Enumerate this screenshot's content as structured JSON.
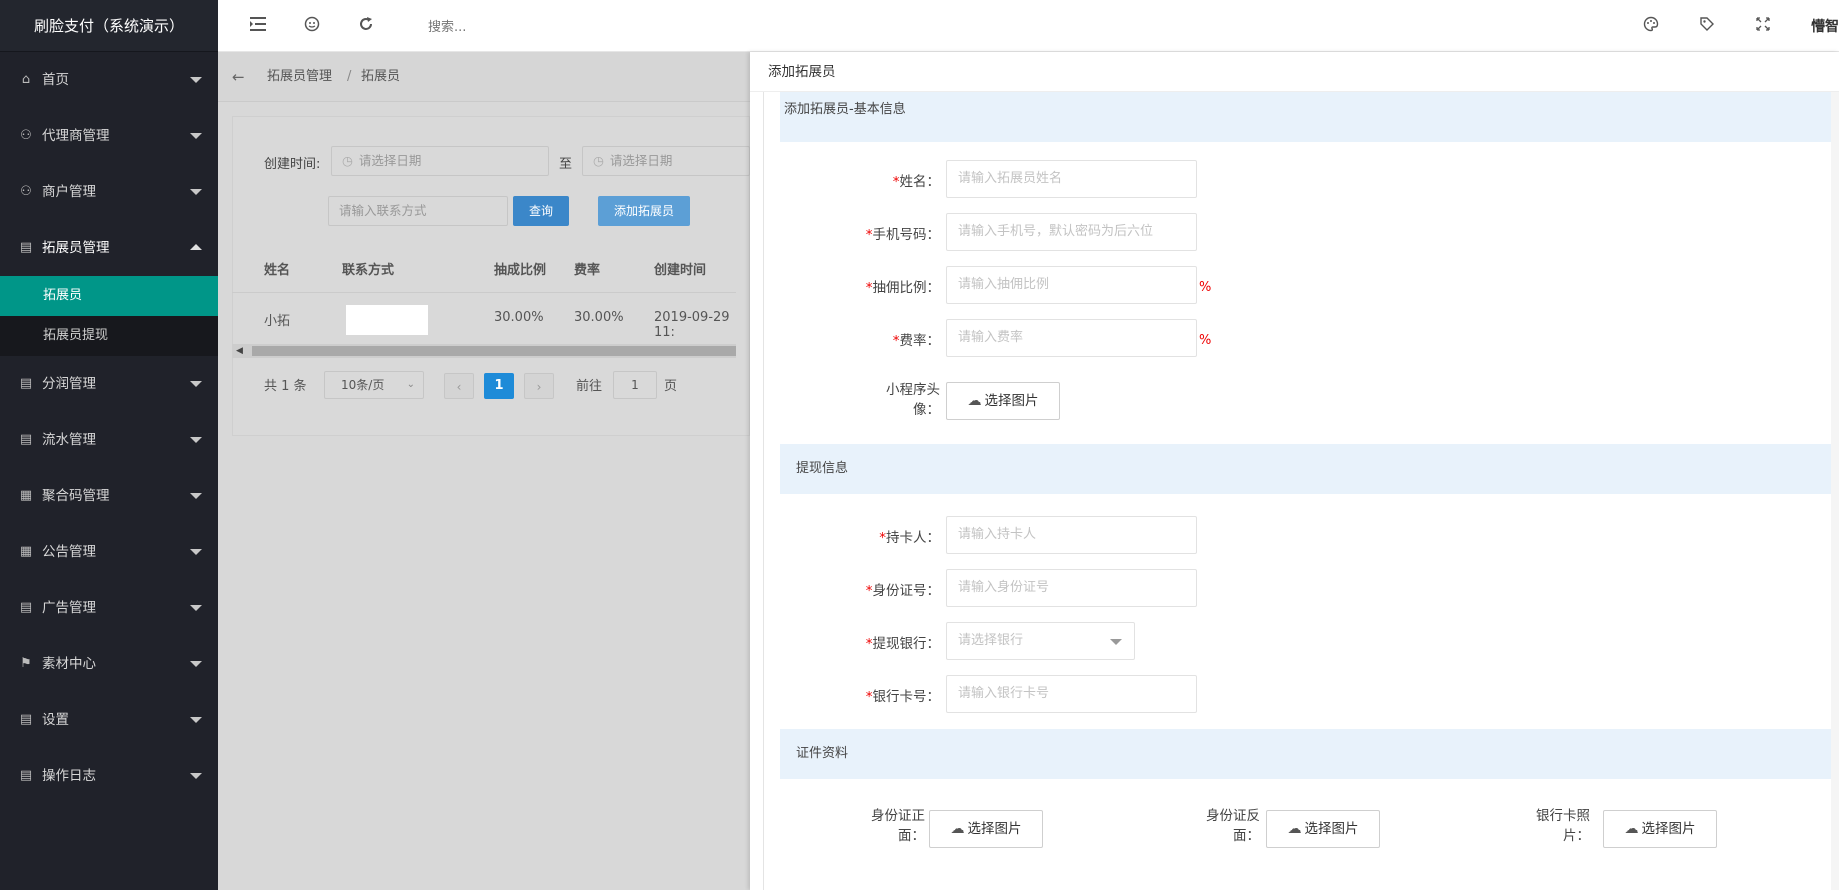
{
  "app": {
    "title": "刷脸支付（系统演示）"
  },
  "sidebar": {
    "items": [
      {
        "label": "首页",
        "icon": "home-icon",
        "glyph": "⌂"
      },
      {
        "label": "代理商管理",
        "icon": "user-icon",
        "glyph": "⚇"
      },
      {
        "label": "商户管理",
        "icon": "user-icon",
        "glyph": "⚇"
      },
      {
        "label": "拓展员管理",
        "icon": "clipboard-icon",
        "glyph": "▤",
        "open": true
      },
      {
        "label": "分润管理",
        "icon": "clipboard-icon",
        "glyph": "▤"
      },
      {
        "label": "流水管理",
        "icon": "clipboard-icon",
        "glyph": "▤"
      },
      {
        "label": "聚合码管理",
        "icon": "qrcode-icon",
        "glyph": "▦"
      },
      {
        "label": "公告管理",
        "icon": "qrcode-icon",
        "glyph": "▦"
      },
      {
        "label": "广告管理",
        "icon": "clipboard-icon",
        "glyph": "▤"
      },
      {
        "label": "素材中心",
        "icon": "flag-icon",
        "glyph": "⚑"
      },
      {
        "label": "设置",
        "icon": "clipboard-icon",
        "glyph": "▤"
      },
      {
        "label": "操作日志",
        "icon": "clipboard-icon",
        "glyph": "▤"
      }
    ],
    "sub_items": [
      "拓展员",
      "拓展员提现"
    ]
  },
  "header": {
    "search_placeholder": "搜索...",
    "user": "懵智",
    "icons": [
      "menu-toggle-icon",
      "globe-icon",
      "refresh-icon",
      "theme-icon",
      "tag-icon",
      "fullscreen-icon"
    ]
  },
  "breadcrumb": {
    "back": "←",
    "items": [
      "拓展员管理",
      "拓展员"
    ],
    "separator": "/"
  },
  "filter": {
    "created_label": "创建时间:",
    "date_placeholder_start": "请选择日期",
    "to_label": "至",
    "date_placeholder_end": "请选择日期",
    "contact_placeholder": "请输入联系方式",
    "query_button": "查询",
    "add_button": "添加拓展员"
  },
  "table": {
    "columns": [
      "姓名",
      "联系方式",
      "抽成比例",
      "费率",
      "创建时间"
    ],
    "rows": [
      {
        "name": "小拓",
        "contact": "",
        "commission": "30.00%",
        "rate": "30.00%",
        "created": "2019-09-29 11:"
      }
    ]
  },
  "pagination": {
    "total": "共 1 条",
    "page_size": "10条/页",
    "prev": "‹",
    "current": "1",
    "next": "›",
    "goto_label": "前往",
    "goto_value": "1",
    "page_unit": "页"
  },
  "panel": {
    "title": "添加拓展员",
    "basic_section": "添加拓展员-基本信息",
    "name_label": "姓名：",
    "name_placeholder": "请输入拓展员姓名",
    "phone_label": "手机号码：",
    "phone_placeholder": "请输入手机号，默认密码为后六位",
    "commission_label": "抽佣比例：",
    "commission_placeholder": "请输入抽佣比例",
    "rate_label": "费率：",
    "rate_placeholder": "请输入费率",
    "percent": "%",
    "avatar_label_1": "小程序头",
    "avatar_label_2": "像：",
    "choose_image": "选择图片",
    "withdraw_section": "提现信息",
    "holder_label": "持卡人：",
    "holder_placeholder": "请输入持卡人",
    "idno_label": "身份证号：",
    "idno_placeholder": "请输入身份证号",
    "bank_label": "提现银行：",
    "bank_placeholder": "请选择银行",
    "card_label": "银行卡号：",
    "card_placeholder": "请输入银行卡号",
    "cert_section": "证件资料",
    "id_front_1": "身份证正",
    "id_front_2": "面：",
    "id_back_1": "身份证反",
    "id_back_2": "面：",
    "bankcard_1": "银行卡照",
    "bankcard_2": "片：",
    "required_mark": "*"
  }
}
